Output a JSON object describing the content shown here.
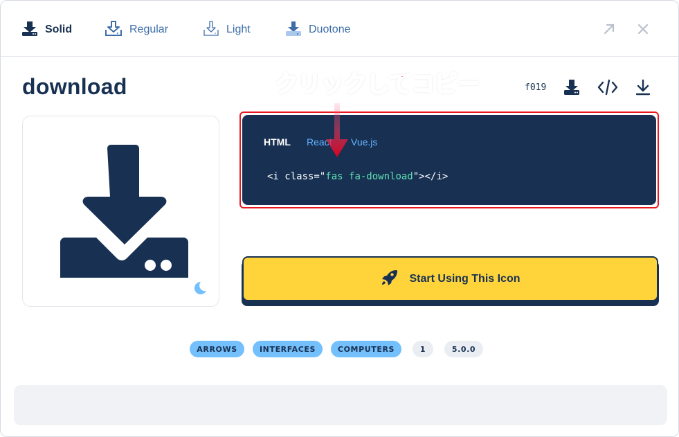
{
  "style_tabs": [
    {
      "label": "Solid",
      "active": true
    },
    {
      "label": "Regular",
      "active": false
    },
    {
      "label": "Light",
      "active": false
    },
    {
      "label": "Duotone",
      "active": false
    }
  ],
  "icon": {
    "name": "download",
    "unicode": "f019"
  },
  "annotation": {
    "text": "クリックしてコピー"
  },
  "code": {
    "tabs": [
      "HTML",
      "React",
      "Vue.js"
    ],
    "active_tab": "HTML",
    "prefix": "<i class=\"",
    "class_value": "fas fa-download",
    "suffix": "\"></i>"
  },
  "start_button": {
    "label": "Start Using This Icon"
  },
  "tags": {
    "categories": [
      "ARROWS",
      "INTERFACES",
      "COMPUTERS"
    ],
    "versions": [
      "1",
      "5.0.0"
    ]
  },
  "colors": {
    "navy": "#183153",
    "yellow": "#ffd43b",
    "link_blue": "#3d6ea8",
    "code_string": "#5fe0b2",
    "tag_blue": "#74c0fc",
    "annotation_pink": "#ff3d7a",
    "highlight_red": "#e8191f"
  },
  "icons": {
    "style_tabs": [
      "download-solid-icon",
      "download-regular-icon",
      "download-light-icon",
      "download-duotone-icon"
    ],
    "window": [
      "expand-icon",
      "close-icon"
    ],
    "actions": [
      "download-svg-icon",
      "code-icon",
      "download-icon"
    ],
    "theme": "moon-icon",
    "start": "rocket-icon"
  }
}
